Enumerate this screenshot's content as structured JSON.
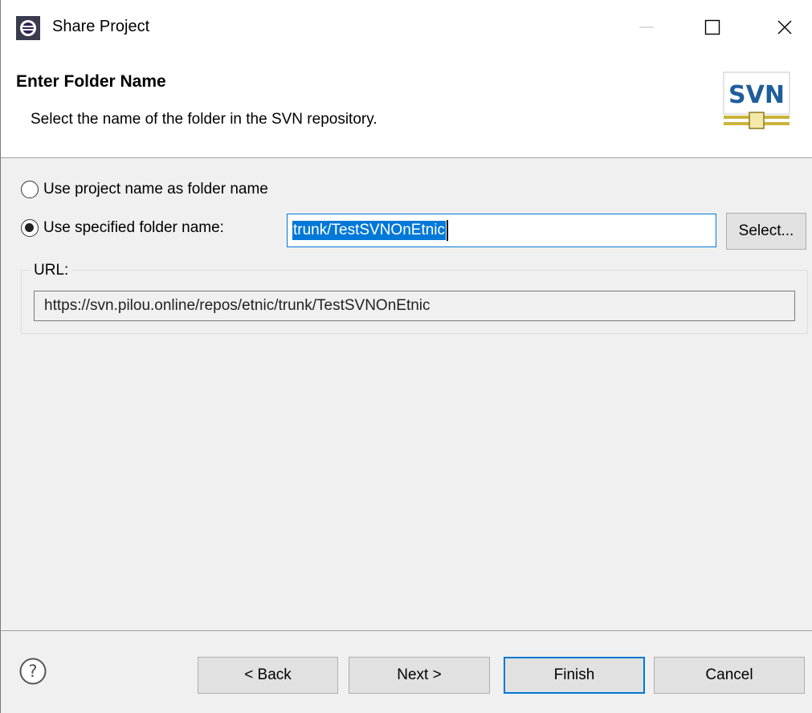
{
  "window": {
    "title": "Share Project",
    "app_icon": "eclipse-icon",
    "controls": [
      "minimize-icon",
      "maximize-icon",
      "close-icon"
    ]
  },
  "banner": {
    "title": "Enter Folder Name",
    "description": "Select the name of the folder in the SVN repository.",
    "logo_text": "SVN"
  },
  "options": {
    "project_name_label": "Use project name as folder name",
    "specified_name_label": "Use specified folder name:",
    "selected": "specified"
  },
  "folder": {
    "value": "trunk/TestSVNOnEtnic",
    "select_label": "Select..."
  },
  "url": {
    "legend": "URL:",
    "value": "https://svn.pilou.online/repos/etnic/trunk/TestSVNOnEtnic"
  },
  "footer": {
    "help_icon": "help-icon",
    "back_label": "< Back",
    "next_label": "Next >",
    "finish_label": "Finish",
    "cancel_label": "Cancel"
  },
  "colors": {
    "accent": "#0078d7",
    "svn_blue": "#1f5e9c",
    "svn_gold": "#c9b43a"
  }
}
